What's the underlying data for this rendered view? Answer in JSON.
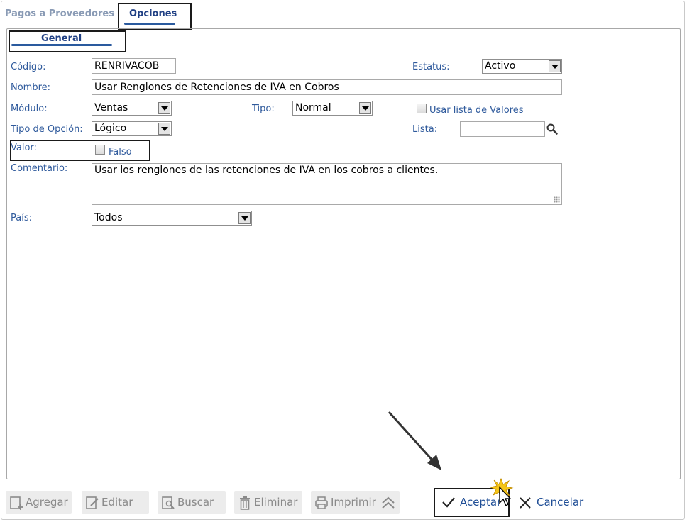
{
  "tabs": [
    {
      "label": "Pagos a Proveedores",
      "active": false
    },
    {
      "label": "Opciones",
      "active": true
    }
  ],
  "subtab": {
    "label": "General"
  },
  "form": {
    "codigo": {
      "label": "Código:",
      "value": "RENRIVACOB"
    },
    "estatus": {
      "label": "Estatus:",
      "value": "Activo"
    },
    "nombre": {
      "label": "Nombre:",
      "value": "Usar Renglones de Retenciones de IVA en Cobros"
    },
    "modulo": {
      "label": "Módulo:",
      "value": "Ventas"
    },
    "tipo": {
      "label": "Tipo:",
      "value": "Normal"
    },
    "usar_lista": {
      "label": "Usar lista de Valores",
      "checked": false
    },
    "tipo_opcion": {
      "label": "Tipo de Opción:",
      "value": "Lógico"
    },
    "lista": {
      "label": "Lista:",
      "value": ""
    },
    "valor": {
      "label": "Valor:",
      "checkbox_label": "Falso",
      "checked": false
    },
    "comentario": {
      "label": "Comentario:",
      "value": "Usar los renglones de las retenciones de IVA en los cobros a clientes."
    },
    "pais": {
      "label": "País:",
      "value": "Todos"
    }
  },
  "toolbar": {
    "agregar": "Agregar",
    "editar": "Editar",
    "buscar": "Buscar",
    "eliminar": "Eliminar",
    "imprimir": "Imprimir"
  },
  "actions": {
    "aceptar": "Aceptar",
    "cancelar": "Cancelar"
  },
  "icons": {
    "search": "magnifier-icon",
    "collapse": "double-chevron-up-icon",
    "accept": "checkmark-icon",
    "cancel": "x-icon",
    "cursor": "mouse-pointer-icon",
    "arrow": "annotation-arrow-icon"
  },
  "colors": {
    "label": "#2f5a9c",
    "tab_active": "#1f3f83",
    "tab_inactive": "#8a9bb5",
    "accent_underline": "#2a5a9e",
    "highlight_box": "#1a1a1a"
  }
}
